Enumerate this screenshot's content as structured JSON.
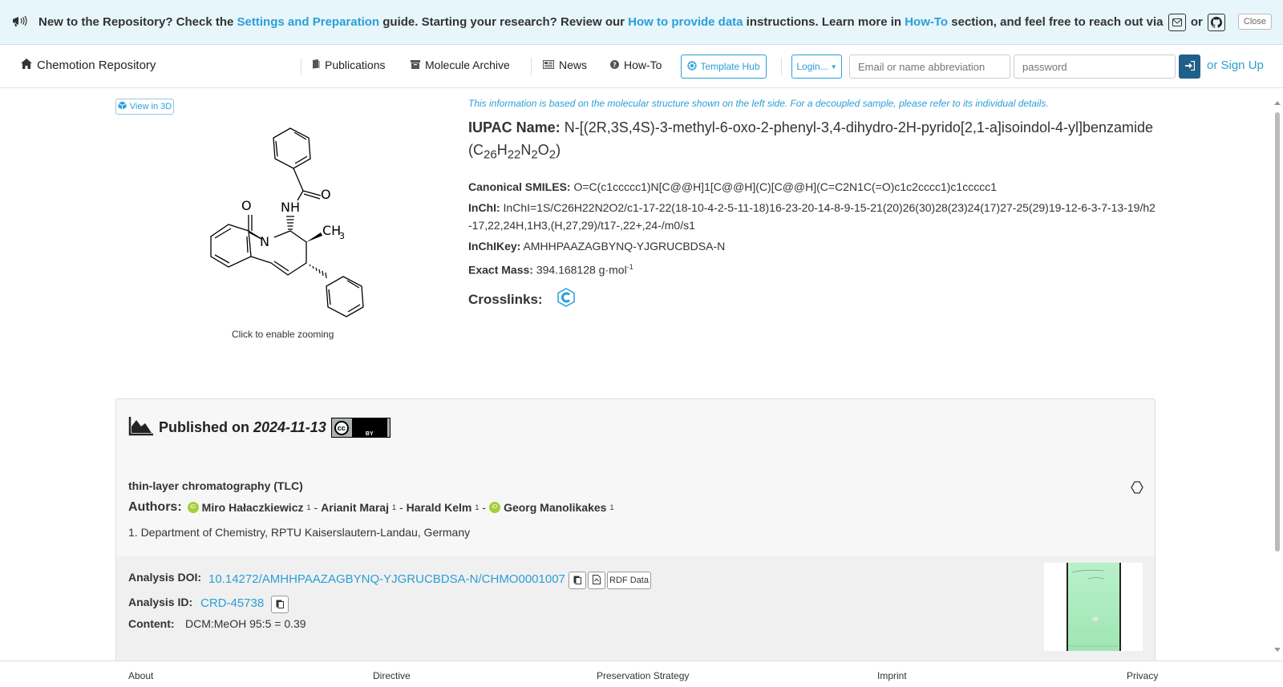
{
  "banner": {
    "text1": "New to the Repository? Check the ",
    "link1": "Settings and Preparation",
    "text2": " guide. Starting your research? Review our ",
    "link2": "How to provide data",
    "text3": " instructions. Learn more in ",
    "link3": "How-To",
    "text4": " section, and feel free to reach out via ",
    "text5": " or ",
    "close_label": "Close"
  },
  "nav": {
    "brand": "Chemotion Repository",
    "items": [
      "Publications",
      "Molecule Archive",
      "News",
      "How-To"
    ],
    "template_hub": "Template Hub",
    "login": "Login...",
    "email_placeholder": "Email or name abbreviation",
    "password_placeholder": "password",
    "signup": "or Sign Up"
  },
  "molecule": {
    "view3d": "View in 3D",
    "zoom_hint": "Click to enable zooming",
    "atoms": {
      "o1": "O",
      "o2": "O",
      "nh": "NH",
      "n": "N",
      "ch3": "CH",
      "ch3_sub": "3"
    }
  },
  "info": {
    "note": "This information is based on the molecular structure shown on the left side. For a decoupled sample, please refer to its individual details.",
    "iupac_label": "IUPAC Name:",
    "iupac_value": "N-[(2R,3S,4S)-3-methyl-6-oxo-2-phenyl-3,4-dihydro-2H-pyrido[2,1-a]isoindol-4-yl]benzamide",
    "formula": {
      "c": "26",
      "h": "22",
      "n": "2",
      "o": "2"
    },
    "smiles_label": "Canonical SMILES:",
    "smiles": "O=C(c1ccccc1)N[C@@H]1[C@@H](C)[C@@H](C=C2N1C(=O)c1c2cccc1)c1ccccc1",
    "inchi_label": "InChI:",
    "inchi": "InChI=1S/C26H22N2O2/c1-17-22(18-10-4-2-5-11-18)16-23-20-14-8-9-15-21(20)26(30)28(23)24(17)27-25(29)19-12-6-3-7-13-19/h2-17,22,24H,1H3,(H,27,29)/t17-,22+,24-/m0/s1",
    "inchikey_label": "InChIKey:",
    "inchikey": "AMHHPAAZAGBYNQ-YJGRUCBDSA-N",
    "mass_label": "Exact Mass:",
    "mass": "394.168128 g·mol",
    "mass_sup": "-1",
    "crosslinks_label": "Crosslinks:"
  },
  "dataset": {
    "published_prefix": "Published on ",
    "published_date": "2024-11-13",
    "license_by": "BY",
    "method": "thin-layer chromatography (TLC)",
    "authors_label": "Authors:",
    "authors": [
      {
        "name": "Miro Hałaczkiewicz",
        "sup": "1",
        "orcid": true
      },
      {
        "name": "Arianit Maraj",
        "sup": "1",
        "orcid": false
      },
      {
        "name": "Harald Kelm",
        "sup": "1",
        "orcid": false
      },
      {
        "name": "Georg Manolikakes",
        "sup": "1",
        "orcid": true
      }
    ],
    "affiliation": "1. Department of Chemistry, RPTU Kaiserslautern-Landau, Germany",
    "doi_label": "Analysis DOI:",
    "doi": "10.14272/AMHHPAAZAGBYNQ-YJGRUCBDSA-N/CHMO0001007",
    "rdf_label": "RDF Data",
    "id_label": "Analysis ID:",
    "id": "CRD-45738",
    "content_label": "Content:",
    "content": "DCM:MeOH 95:5 = 0.39"
  },
  "footer": [
    "About",
    "Directive",
    "Preservation Strategy",
    "Imprint",
    "Privacy"
  ],
  "colors": {
    "accent": "#2a9fd6",
    "banner_bg": "#e7f6fb",
    "signin": "#1f5f88"
  }
}
